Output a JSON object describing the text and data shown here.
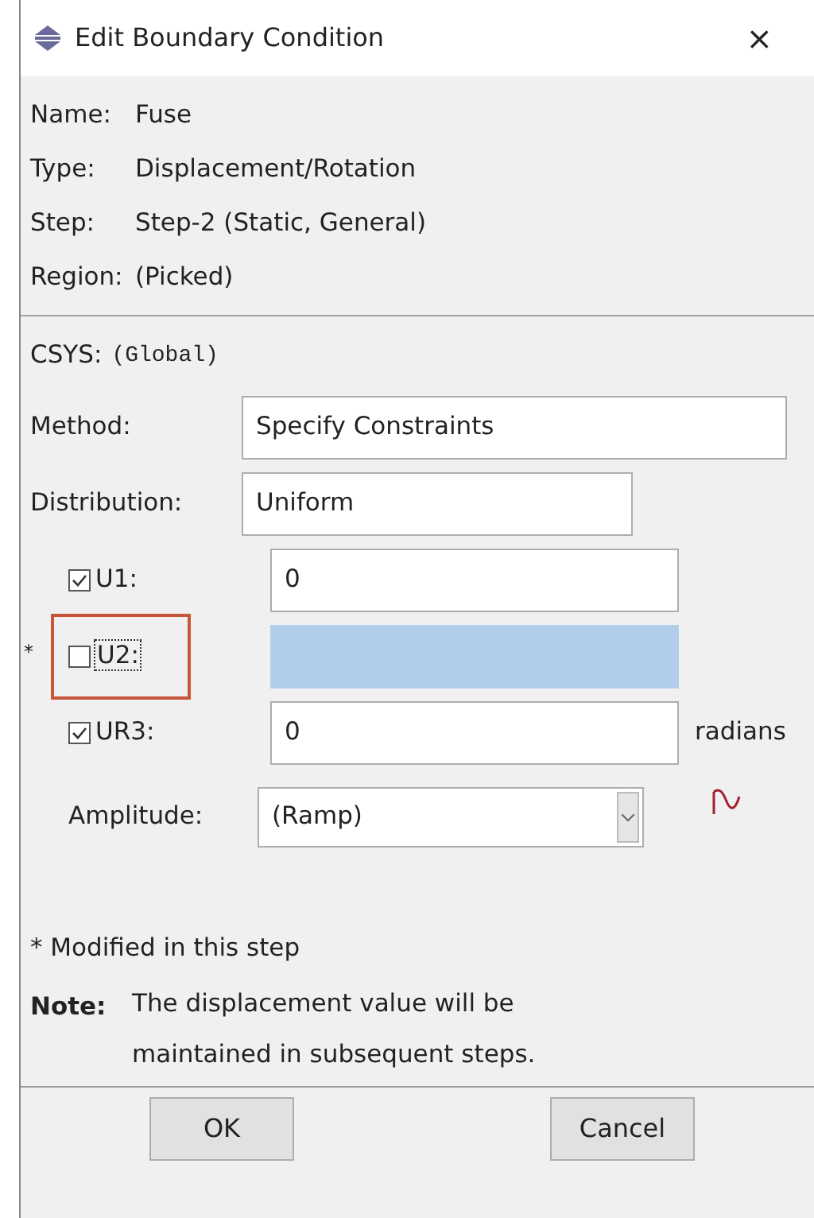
{
  "window": {
    "title": "Edit Boundary Condition",
    "close": "×"
  },
  "info": [
    {
      "label": "Name:",
      "value": "Fuse"
    },
    {
      "label": "Type:",
      "value": "Displacement/Rotation"
    },
    {
      "label": "Step:",
      "value": "Step-2 (Static, General)"
    },
    {
      "label": "Region:",
      "value": "(Picked)"
    }
  ],
  "csys": {
    "label": "CSYS:",
    "value": "(Global)"
  },
  "method": {
    "label": "Method:",
    "value": "Specify Constraints"
  },
  "distribution": {
    "label": "Distribution:",
    "value": "Uniform"
  },
  "constraints": [
    {
      "label": "U1:",
      "checked": true,
      "value": "0",
      "highlighted": false,
      "focused": false
    },
    {
      "marker": "*",
      "label": "U2:",
      "checked": false,
      "highlighted": true,
      "focused": true,
      "annotated": true
    },
    {
      "label": "UR3:",
      "checked": true,
      "value": "0",
      "unit": "radians",
      "highlighted": false,
      "focused": false
    }
  ],
  "amplitude": {
    "label": "Amplitude:",
    "value": "(Ramp)"
  },
  "footnote": "* Modified in this step",
  "note": {
    "label": "Note:",
    "text": "The displacement value will be maintained in subsequent steps."
  },
  "buttons": [
    "OK",
    "Cancel"
  ]
}
